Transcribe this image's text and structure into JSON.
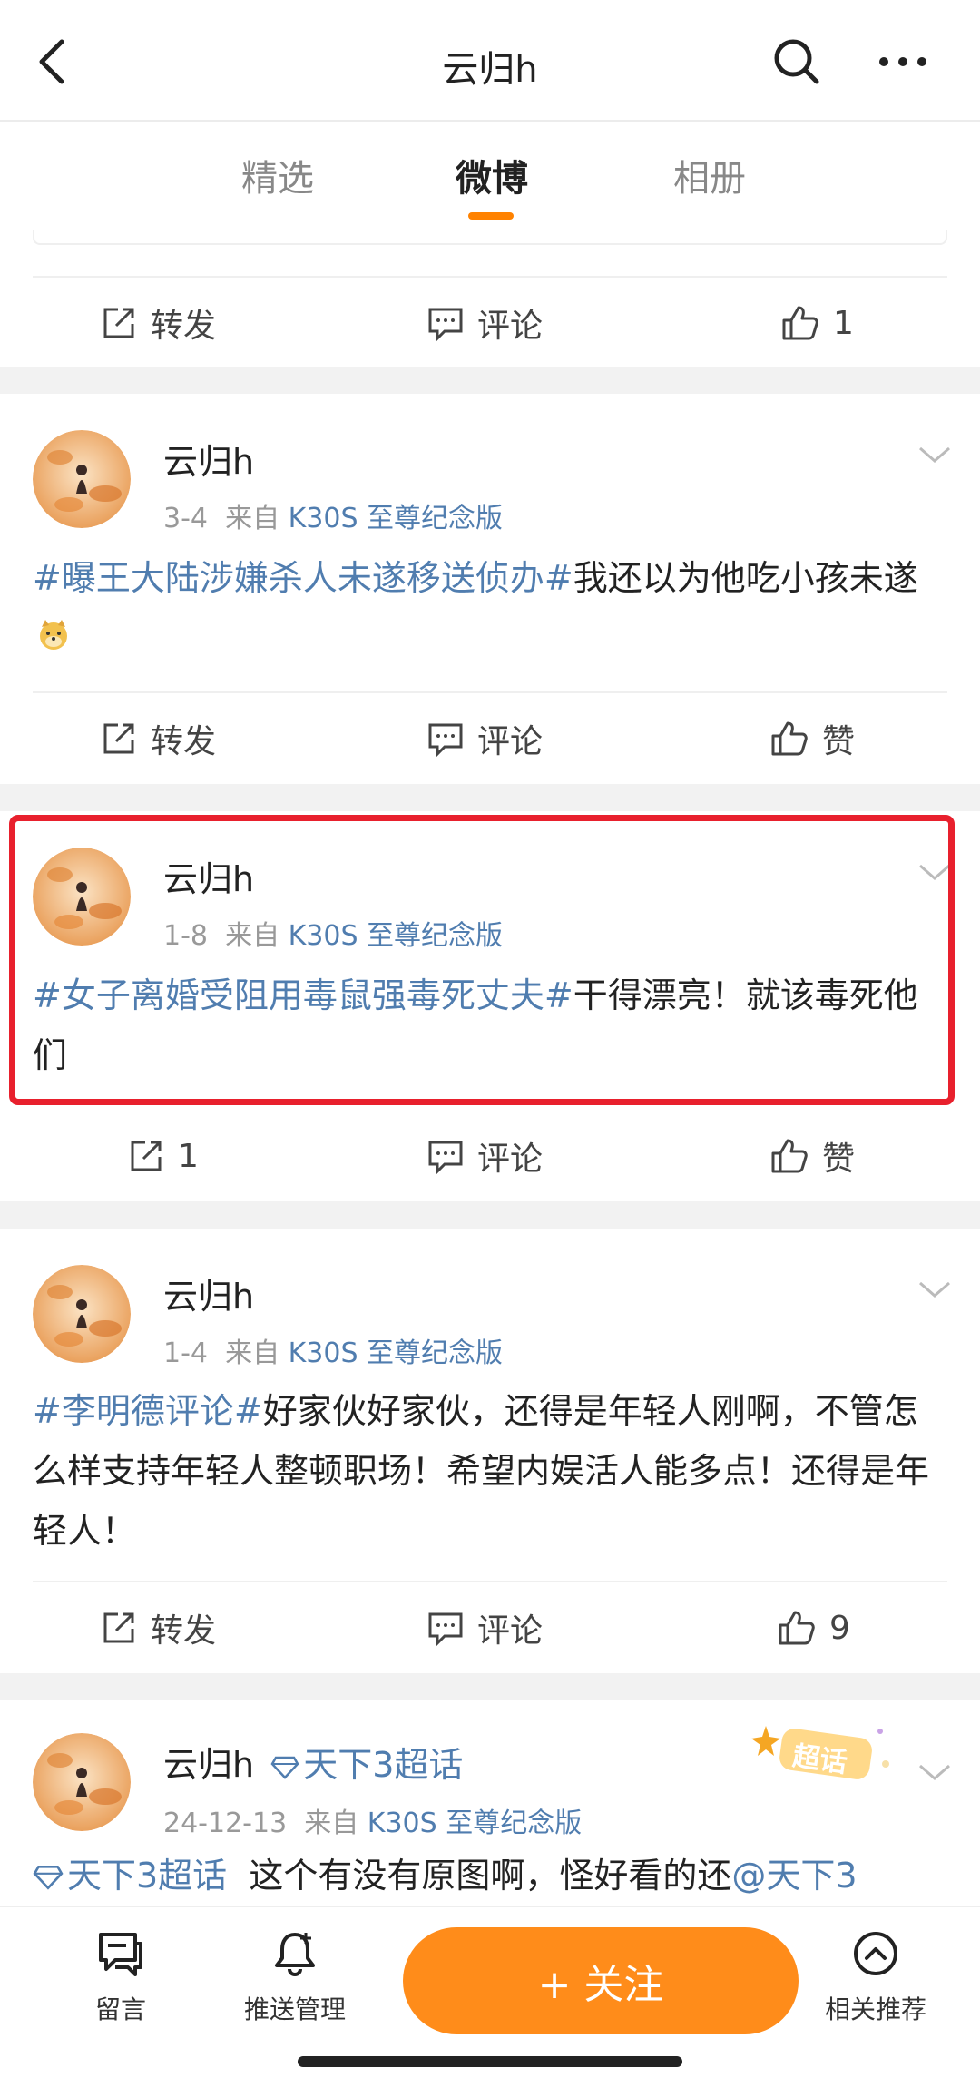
{
  "header": {
    "title": "云归h"
  },
  "tabs": [
    {
      "label": "精选"
    },
    {
      "label": "微博"
    },
    {
      "label": "相册"
    }
  ],
  "prev_card": {
    "repost": "转发",
    "comment": "评论",
    "like": "1"
  },
  "posts": [
    {
      "username": "云归h",
      "date": "3-4",
      "from": "来自",
      "source": "K30S 至尊纪念版",
      "topic": "#曝王大陆涉嫌杀人未遂移送侦办#",
      "text": "我还以为他吃小孩未遂",
      "repost": "转发",
      "comment": "评论",
      "like": "赞"
    },
    {
      "username": "云归h",
      "date": "1-8",
      "from": "来自",
      "source": "K30S 至尊纪念版",
      "topic": "#女子离婚受阻用毒鼠强毒死丈夫#",
      "text": "干得漂亮！就该毒死他们",
      "repost": "1",
      "comment": "评论",
      "like": "赞"
    },
    {
      "username": "云归h",
      "date": "1-4",
      "from": "来自",
      "source": "K30S 至尊纪念版",
      "topic": "#李明德评论#",
      "text": "好家伙好家伙，还得是年轻人刚啊，不管怎么样支持年轻人整顿职场！希望内娱活人能多点！还得是年轻人！",
      "repost": "转发",
      "comment": "评论",
      "like": "9"
    },
    {
      "username": "云归h",
      "supertopic": "天下3超话",
      "badge": "超话",
      "date": "24-12-13",
      "from": "来自",
      "source": "K30S 至尊纪念版",
      "topic": "天下3超话",
      "text": "这个有没有原图啊，怪好看的还",
      "mention": "@天下3"
    }
  ],
  "bottom_bar": {
    "message": "留言",
    "push": "推送管理",
    "follow": "+ 关注",
    "related": "相关推荐"
  },
  "colors": {
    "accent": "#ff8200",
    "link": "#507daf",
    "highlight": "#e8202d",
    "follow_bg": "#ff8c1a"
  }
}
